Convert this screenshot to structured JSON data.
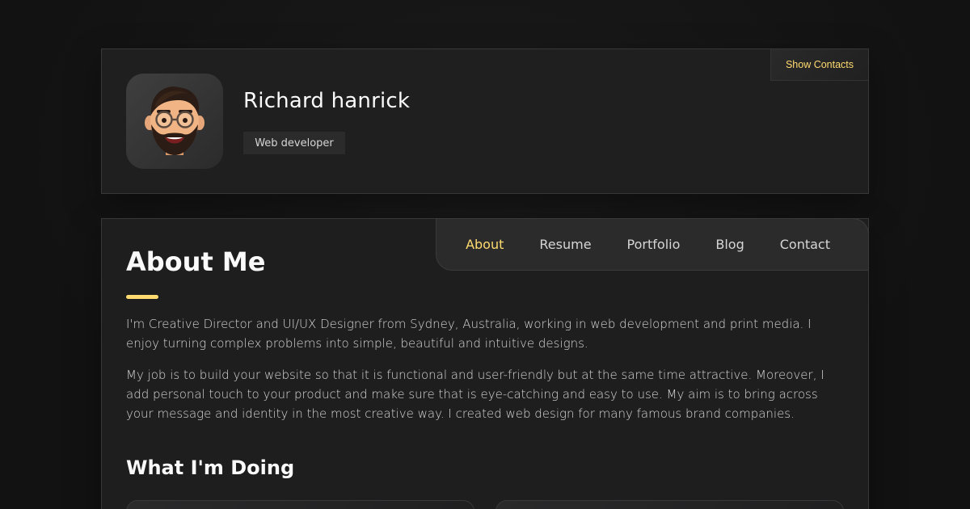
{
  "profile": {
    "name": "Richard hanrick",
    "role": "Web developer",
    "show_contacts_label": "Show Contacts",
    "avatar_icon": "memoji-avatar-icon"
  },
  "nav": {
    "items": [
      {
        "label": "About",
        "active": true
      },
      {
        "label": "Resume",
        "active": false
      },
      {
        "label": "Portfolio",
        "active": false
      },
      {
        "label": "Blog",
        "active": false
      },
      {
        "label": "Contact",
        "active": false
      }
    ]
  },
  "about": {
    "title": "About Me",
    "paragraphs": [
      "I'm Creative Director and UI/UX Designer from Sydney, Australia, working in web development and print media. I enjoy turning complex problems into simple, beautiful and intuitive designs.",
      "My job is to build your website so that it is functional and user-friendly but at the same time attractive. Moreover, I add personal touch to your product and make sure that is eye-catching and easy to use. My aim is to bring across your message and identity in the most creative way. I created web design for many famous brand companies."
    ],
    "services_title": "What I'm Doing"
  },
  "colors": {
    "accent": "#ffdb70",
    "background": "#121212",
    "card": "#1e1e1f",
    "text": "#fafafa",
    "muted_text": "#d6d6d6"
  }
}
